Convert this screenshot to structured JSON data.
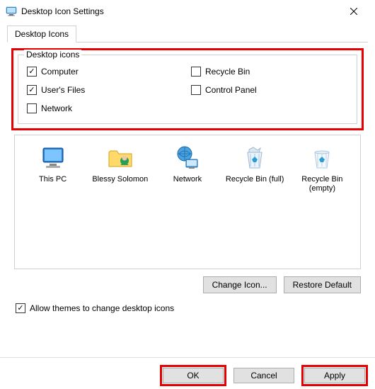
{
  "window": {
    "title": "Desktop Icon Settings"
  },
  "tabs": {
    "active": "Desktop Icons"
  },
  "fieldset": {
    "legend": "Desktop icons",
    "checks": {
      "computer": {
        "label": "Computer",
        "checked": true
      },
      "recycle": {
        "label": "Recycle Bin",
        "checked": false
      },
      "userfiles": {
        "label": "User's Files",
        "checked": true
      },
      "control": {
        "label": "Control Panel",
        "checked": false
      },
      "network": {
        "label": "Network",
        "checked": false
      }
    }
  },
  "preview": {
    "items": {
      "thispc": {
        "label": "This PC"
      },
      "user": {
        "label": "Blessy Solomon"
      },
      "net": {
        "label": "Network"
      },
      "rbfull": {
        "label": "Recycle Bin (full)"
      },
      "rbempty": {
        "label": "Recycle Bin (empty)"
      }
    }
  },
  "buttons": {
    "changeIcon": "Change Icon...",
    "restoreDefault": "Restore Default",
    "ok": "OK",
    "cancel": "Cancel",
    "apply": "Apply"
  },
  "allowThemes": {
    "label": "Allow themes to change desktop icons",
    "checked": true
  }
}
